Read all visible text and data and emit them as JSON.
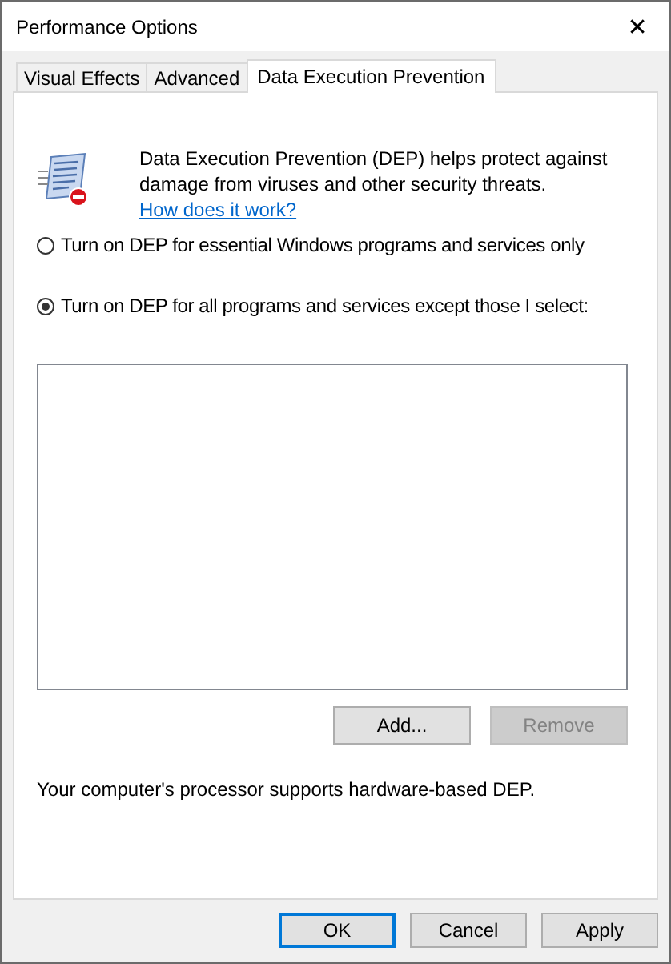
{
  "window": {
    "title": "Performance Options",
    "close": "✕"
  },
  "tabs": [
    {
      "label": "Visual Effects",
      "selected": false
    },
    {
      "label": "Advanced",
      "selected": false
    },
    {
      "label": "Data Execution Prevention",
      "selected": true
    }
  ],
  "description": {
    "text": "Data Execution Prevention (DEP) helps protect against damage from viruses and other security threats.",
    "link": "How does it work?"
  },
  "options": [
    {
      "label": "Turn on DEP for essential Windows programs and services only",
      "selected": false
    },
    {
      "label": "Turn on DEP for all programs and services except those I select:",
      "selected": true
    }
  ],
  "list_buttons": [
    {
      "label": "Add...",
      "disabled": false
    },
    {
      "label": "Remove",
      "disabled": true
    }
  ],
  "status": "Your computer's processor supports hardware-based DEP.",
  "dialog_buttons": [
    {
      "label": "OK",
      "default": true
    },
    {
      "label": "Cancel",
      "default": false
    },
    {
      "label": "Apply",
      "default": false
    }
  ]
}
